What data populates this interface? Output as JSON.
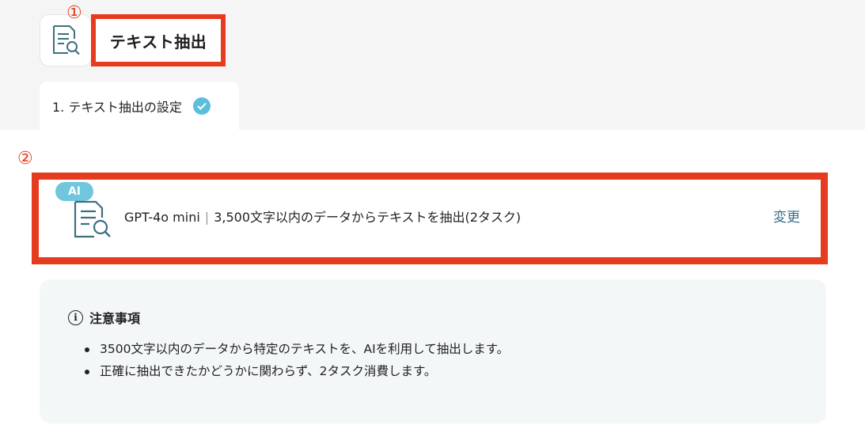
{
  "header": {
    "title": "テキスト抽出",
    "marker_1": "①",
    "marker_2": "②"
  },
  "steps": [
    {
      "label": "1. テキスト抽出の設定",
      "status": "completed"
    }
  ],
  "ai_action": {
    "badge": "AI",
    "model": "GPT-4o mini",
    "separator": "|",
    "description": "3,500文字以内のデータからテキストを抽出(2タスク)",
    "change_label": "変更"
  },
  "notice": {
    "heading": "注意事項",
    "items": [
      "3500文字以内のデータから特定のテキストを、AIを利用して抽出します。",
      "正確に抽出できたかどうかに関わらず、2タスク消費します。"
    ]
  },
  "colors": {
    "highlight_border": "#e53b1f",
    "accent": "#5bbfdc",
    "link": "#3d6f8c",
    "notice_bg": "#f3f7f8"
  }
}
